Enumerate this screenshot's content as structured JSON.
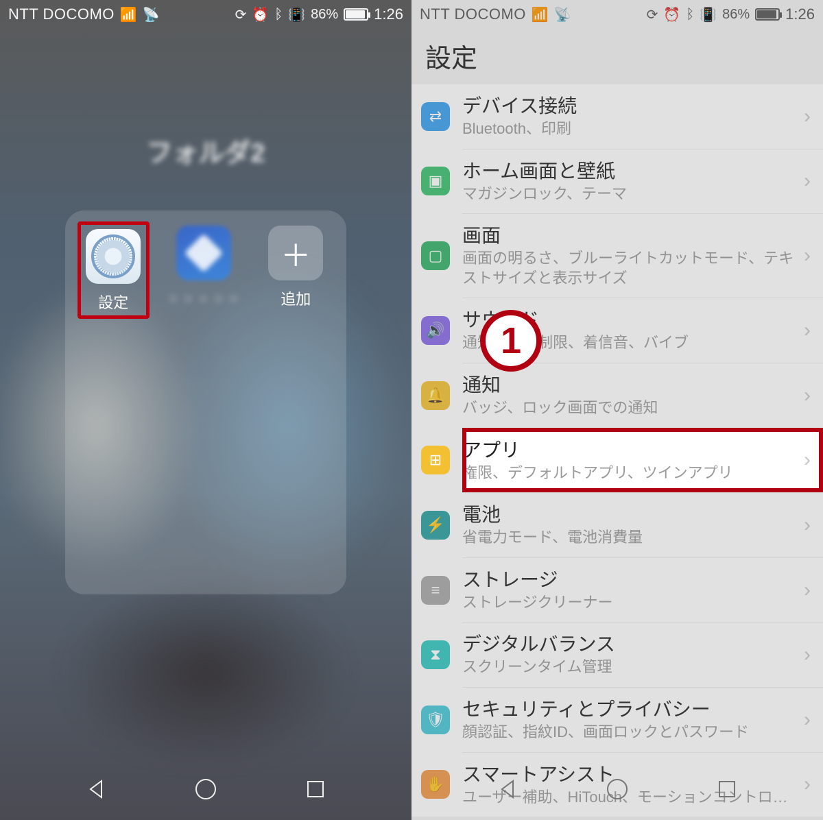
{
  "left": {
    "status": {
      "carrier": "NTT DOCOMO",
      "battery_pct": "86%",
      "time": "1:26"
    },
    "folder_title": "フォルダ2",
    "apps": {
      "settings_label": "設定",
      "blurred_label": "・・・・・",
      "add_label": "追加"
    }
  },
  "right": {
    "status": {
      "carrier": "NTT DOCOMO",
      "battery_pct": "86%",
      "time": "1:26"
    },
    "title": "設定",
    "annotation": "1",
    "rows": [
      {
        "id": "device-connection",
        "icon_color": "ic-blue",
        "glyph": "⇄",
        "title": "デバイス接続",
        "sub": "Bluetooth、印刷"
      },
      {
        "id": "home-wallpaper",
        "icon_color": "ic-green",
        "glyph": "▣",
        "title": "ホーム画面と壁紙",
        "sub": "マガジンロック、テーマ"
      },
      {
        "id": "display",
        "icon_color": "ic-green2",
        "glyph": "▢",
        "title": "画面",
        "sub": "画面の明るさ、ブルーライトカットモード、テキストサイズと表示サイズ"
      },
      {
        "id": "sound",
        "icon_color": "ic-purple",
        "glyph": "🔊",
        "title": "サウンド",
        "sub": "通知の鳴動制限、着信音、バイブ"
      },
      {
        "id": "notifications",
        "icon_color": "ic-yellow",
        "glyph": "🔔",
        "title": "通知",
        "sub": "バッジ、ロック画面での通知"
      },
      {
        "id": "apps",
        "icon_color": "ic-yellow2",
        "glyph": "⊞",
        "title": "アプリ",
        "sub": "権限、デフォルトアプリ、ツインアプリ",
        "highlight": true
      },
      {
        "id": "battery",
        "icon_color": "ic-teal",
        "glyph": "⚡",
        "title": "電池",
        "sub": "省電力モード、電池消費量"
      },
      {
        "id": "storage",
        "icon_color": "ic-gray",
        "glyph": "≡",
        "title": "ストレージ",
        "sub": "ストレージクリーナー"
      },
      {
        "id": "digital-balance",
        "icon_color": "ic-teal2",
        "glyph": "⧗",
        "title": "デジタルバランス",
        "sub": "スクリーンタイム管理"
      },
      {
        "id": "security",
        "icon_color": "ic-cyan",
        "glyph": "🛡",
        "title": "セキュリティとプライバシー",
        "sub": "顔認証、指紋ID、画面ロックとパスワード"
      },
      {
        "id": "smart-assist",
        "icon_color": "ic-orange",
        "glyph": "✋",
        "title": "スマートアシスト",
        "sub": "ユーザー補助、HiTouch、モーションコントロ…"
      }
    ]
  }
}
